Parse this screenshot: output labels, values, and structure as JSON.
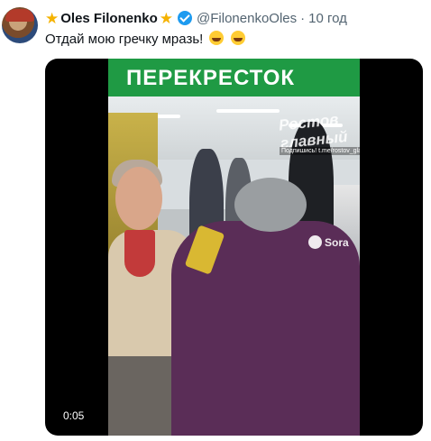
{
  "tweet": {
    "author_name": "Oles Filonenko",
    "author_stars": "★",
    "handle": "@FilonenkoOles",
    "separator": "·",
    "time": "10 год",
    "text": "Отдай мою гречку мразь!",
    "emojis": [
      "rofl-emoji",
      "joy-emoji"
    ]
  },
  "media": {
    "store_sign": "ПЕРЕКРЕСТОК",
    "watermark_title": "Ростов главный",
    "watermark_caption": "Подпишись! t.me/rostov_glavniy",
    "sora_label": "Sora",
    "duration": "0:05"
  },
  "colors": {
    "accent": "#1d9bf0",
    "star": "#f5b200",
    "store_green": "#1f9a44"
  }
}
